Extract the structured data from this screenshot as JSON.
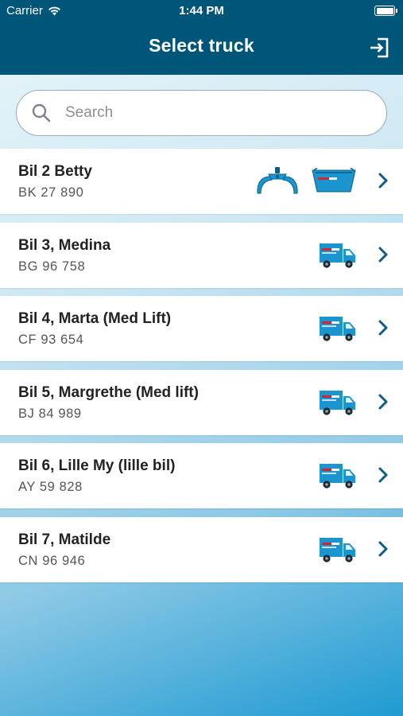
{
  "status_bar": {
    "carrier": "Carrier",
    "time": "1:44 PM"
  },
  "header": {
    "title": "Select truck",
    "logout_icon": "logout-icon"
  },
  "search": {
    "placeholder": "Search",
    "value": ""
  },
  "trucks": [
    {
      "name": "Bil 2 Betty",
      "plate": "BK 27 890",
      "icons": [
        "grab-claw-icon",
        "skip-container-icon"
      ]
    },
    {
      "name": "Bil 3, Medina",
      "plate": "BG 96 758",
      "icons": [
        "truck-icon"
      ]
    },
    {
      "name": "Bil 4, Marta (Med Lift)",
      "plate": "CF 93 654",
      "icons": [
        "truck-icon"
      ]
    },
    {
      "name": "Bil 5, Margrethe (Med lift)",
      "plate": "BJ 84 989",
      "icons": [
        "truck-icon"
      ]
    },
    {
      "name": "Bil 6, Lille My (lille bil)",
      "plate": "AY 59 828",
      "icons": [
        "truck-icon"
      ]
    },
    {
      "name": "Bil 7, Matilde",
      "plate": "CN 96 946",
      "icons": [
        "truck-icon"
      ]
    }
  ],
  "colors": {
    "header": "#005679",
    "accent": "#1a95d0",
    "chevron": "#0b5f86",
    "text": "#222222"
  }
}
